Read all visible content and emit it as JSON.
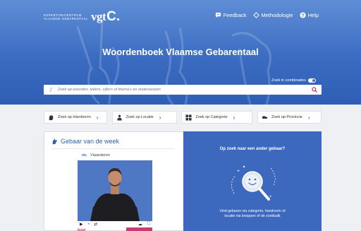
{
  "header": {
    "logo_small_line1": "EXPERTISECENTRUM",
    "logo_small_line2": "VLAAMSE GEBARENTAAL",
    "logo_main": "vgt",
    "logo_mark": "C.",
    "nav": [
      {
        "label": "Feedback",
        "icon": "chat-bubble-icon"
      },
      {
        "label": "Methodologie",
        "icon": "diamond-icon"
      },
      {
        "label": "Help",
        "icon": "question-circle-icon"
      }
    ]
  },
  "hero": {
    "title": "Woordenboek Vlaamse Gebarentaal",
    "toggle_label": "Zoek in combinaties"
  },
  "search": {
    "prefix": "T",
    "placeholder": "Zoek op woorden, letters, cijfers of thema's en onderwerpen"
  },
  "filters": [
    {
      "label": "Zoek op Handvorm",
      "icon": "hand-icon"
    },
    {
      "label": "Zoek op Locatie",
      "icon": "person-icon"
    },
    {
      "label": "Zoek op Categorie",
      "icon": "grid-icon"
    },
    {
      "label": "Zoek op Provincie",
      "icon": "map-icon"
    }
  ],
  "week": {
    "title": "Gebaar van de week",
    "region": "Vlaanderen",
    "word": "boei"
  },
  "promo": {
    "title": "Op zoek naar een ander gebaar?",
    "text": "Vind gebaren via categorie, handvorm of locatie via knoppen of de zoekbalk"
  },
  "colors": {
    "brand_blue": "#3b6cc1",
    "promo_blue": "#3c68bd",
    "accent_pink": "#c83b6e",
    "search_icon": "#c8215a"
  }
}
